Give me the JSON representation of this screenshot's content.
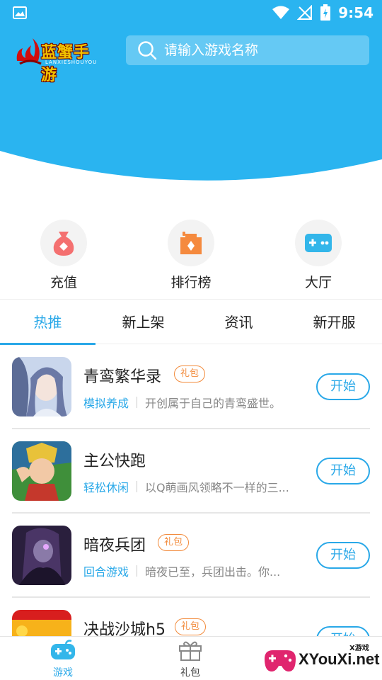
{
  "status_bar": {
    "time": "9:54"
  },
  "brand": {
    "logo_text": "蓝蟹手游",
    "logo_sub": "LANXIESHOUYOU"
  },
  "search": {
    "placeholder": "请输入游戏名称"
  },
  "quick_entries": [
    {
      "label": "充值",
      "icon": "money-bag-icon"
    },
    {
      "label": "排行榜",
      "icon": "ranking-icon"
    },
    {
      "label": "大厅",
      "icon": "gamepad-icon"
    }
  ],
  "tabs": [
    {
      "label": "热推",
      "active": true
    },
    {
      "label": "新上架",
      "active": false
    },
    {
      "label": "资讯",
      "active": false
    },
    {
      "label": "新开服",
      "active": false
    }
  ],
  "games": [
    {
      "name": "青鸾繁华录",
      "badge": "礼包",
      "category": "模拟养成",
      "desc": "开创属于自己的青鸾盛世。",
      "action": "开始"
    },
    {
      "name": "主公快跑",
      "badge": "",
      "category": "轻松休闲",
      "desc": "以Q萌画风领略不一样的三...",
      "action": "开始"
    },
    {
      "name": "暗夜兵团",
      "badge": "礼包",
      "category": "回合游戏",
      "desc": "暗夜已至，兵团出击。你...",
      "action": "开始"
    },
    {
      "name": "决战沙城h5",
      "badge": "礼包",
      "category": "",
      "desc": "",
      "action": "开始"
    }
  ],
  "bottom_nav": [
    {
      "label": "游戏",
      "icon": "gamepad-icon",
      "active": true
    },
    {
      "label": "礼包",
      "icon": "gift-icon",
      "active": false
    }
  ],
  "watermark": {
    "text": "XYouXi.net",
    "small": "X游戏"
  },
  "colors": {
    "primary": "#29a8e8",
    "hero": "#2ab4f0",
    "badge": "#f28b3c"
  }
}
